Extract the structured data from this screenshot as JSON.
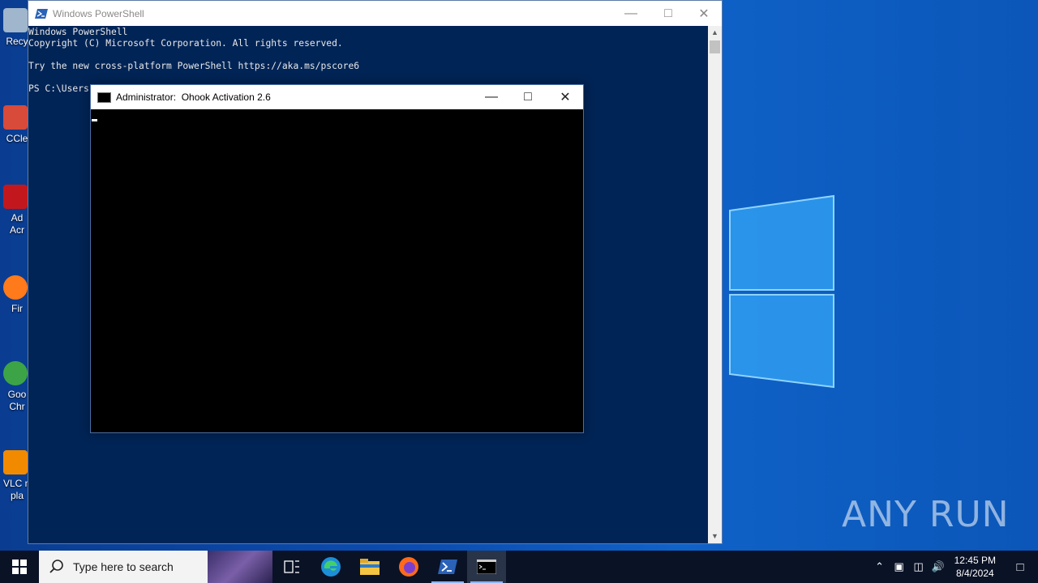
{
  "desktop": {
    "icons": [
      {
        "label": "Recy",
        "icon": "recycle-bin-icon"
      },
      {
        "label": "CCle",
        "icon": "ccleaner-icon"
      },
      {
        "label": "Ad\nAcr",
        "icon": "acrobat-icon"
      },
      {
        "label": "Fir",
        "icon": "firefox-icon"
      },
      {
        "label": "Goo\nChr",
        "icon": "chrome-icon"
      },
      {
        "label": "VLC m\npla",
        "icon": "vlc-icon"
      }
    ],
    "watermark": "ANY RUN"
  },
  "powershell": {
    "title": "Windows PowerShell",
    "lines": [
      "Windows PowerShell",
      "Copyright (C) Microsoft Corporation. All rights reserved.",
      "",
      "Try the new cross-platform PowerShell https://aka.ms/pscore6",
      "",
      "PS C:\\Users"
    ]
  },
  "cmd": {
    "title": "Administrator:  Ohook Activation 2.6"
  },
  "taskbar": {
    "search_placeholder": "Type here to search",
    "time": "12:45 PM",
    "date": "8/4/2024"
  },
  "colors": {
    "powershell_bg": "#012456",
    "desktop_accent": "#0f62c8",
    "taskbar_bg": "#0a1226"
  }
}
